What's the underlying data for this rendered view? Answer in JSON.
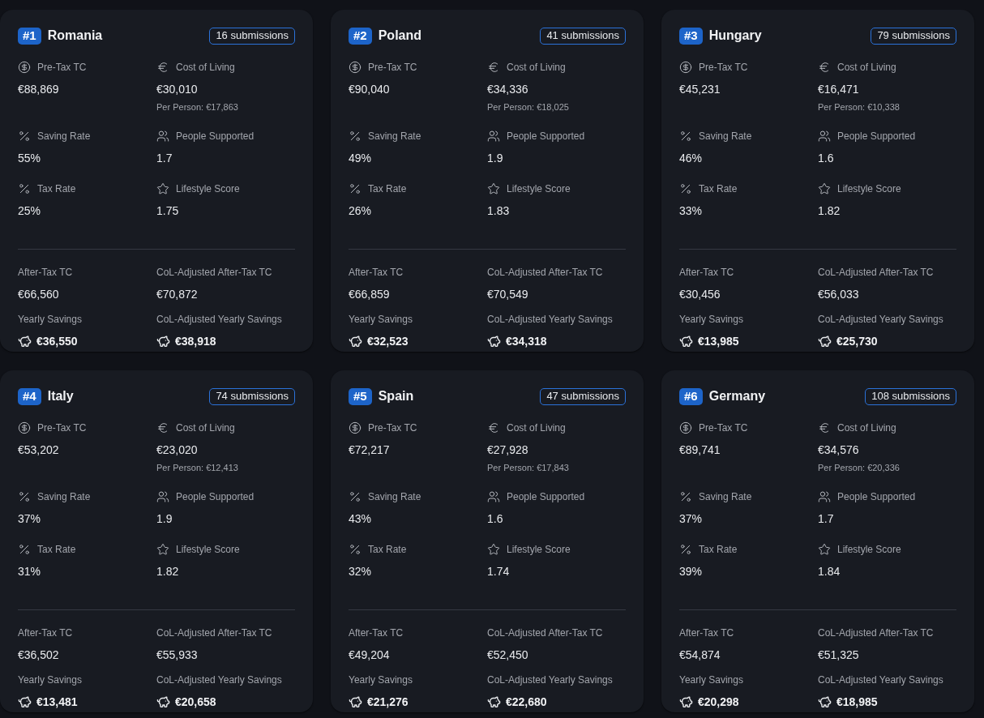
{
  "cards": [
    {
      "rank": "#1",
      "country": "Romania",
      "submissions": "16 submissions",
      "stats": [
        {
          "kind": "dollar",
          "label": "Pre-Tax TC",
          "value": "€88,869"
        },
        {
          "kind": "euro",
          "label": "Cost of Living",
          "value": "€30,010",
          "note": "Per Person: €17,863"
        },
        {
          "kind": "percent",
          "label": "Saving Rate",
          "value": "55%"
        },
        {
          "kind": "people",
          "label": "People Supported",
          "value": "1.7"
        },
        {
          "kind": "percent",
          "label": "Tax Rate",
          "value": "25%"
        },
        {
          "kind": "star",
          "label": "Lifestyle Score",
          "value": "1.75"
        }
      ],
      "summary": [
        {
          "kind": "plain",
          "label": "After-Tax TC",
          "value": "€66,560"
        },
        {
          "kind": "plain",
          "label": "CoL-Adjusted After-Tax TC",
          "value": "€70,872"
        },
        {
          "kind": "savings",
          "label": "Yearly Savings",
          "value": "€36,550"
        },
        {
          "kind": "savings",
          "label": "CoL-Adjusted Yearly Savings",
          "value": "€38,918"
        }
      ]
    },
    {
      "rank": "#2",
      "country": "Poland",
      "submissions": "41 submissions",
      "stats": [
        {
          "kind": "dollar",
          "label": "Pre-Tax TC",
          "value": "€90,040"
        },
        {
          "kind": "euro",
          "label": "Cost of Living",
          "value": "€34,336",
          "note": "Per Person: €18,025"
        },
        {
          "kind": "percent",
          "label": "Saving Rate",
          "value": "49%"
        },
        {
          "kind": "people",
          "label": "People Supported",
          "value": "1.9"
        },
        {
          "kind": "percent",
          "label": "Tax Rate",
          "value": "26%"
        },
        {
          "kind": "star",
          "label": "Lifestyle Score",
          "value": "1.83"
        }
      ],
      "summary": [
        {
          "kind": "plain",
          "label": "After-Tax TC",
          "value": "€66,859"
        },
        {
          "kind": "plain",
          "label": "CoL-Adjusted After-Tax TC",
          "value": "€70,549"
        },
        {
          "kind": "savings",
          "label": "Yearly Savings",
          "value": "€32,523"
        },
        {
          "kind": "savings",
          "label": "CoL-Adjusted Yearly Savings",
          "value": "€34,318"
        }
      ]
    },
    {
      "rank": "#3",
      "country": "Hungary",
      "submissions": "79 submissions",
      "stats": [
        {
          "kind": "dollar",
          "label": "Pre-Tax TC",
          "value": "€45,231"
        },
        {
          "kind": "euro",
          "label": "Cost of Living",
          "value": "€16,471",
          "note": "Per Person: €10,338"
        },
        {
          "kind": "percent",
          "label": "Saving Rate",
          "value": "46%"
        },
        {
          "kind": "people",
          "label": "People Supported",
          "value": "1.6"
        },
        {
          "kind": "percent",
          "label": "Tax Rate",
          "value": "33%"
        },
        {
          "kind": "star",
          "label": "Lifestyle Score",
          "value": "1.82"
        }
      ],
      "summary": [
        {
          "kind": "plain",
          "label": "After-Tax TC",
          "value": "€30,456"
        },
        {
          "kind": "plain",
          "label": "CoL-Adjusted After-Tax TC",
          "value": "€56,033"
        },
        {
          "kind": "savings",
          "label": "Yearly Savings",
          "value": "€13,985"
        },
        {
          "kind": "savings",
          "label": "CoL-Adjusted Yearly Savings",
          "value": "€25,730"
        }
      ]
    },
    {
      "rank": "#4",
      "country": "Italy",
      "submissions": "74 submissions",
      "stats": [
        {
          "kind": "dollar",
          "label": "Pre-Tax TC",
          "value": "€53,202"
        },
        {
          "kind": "euro",
          "label": "Cost of Living",
          "value": "€23,020",
          "note": "Per Person: €12,413"
        },
        {
          "kind": "percent",
          "label": "Saving Rate",
          "value": "37%"
        },
        {
          "kind": "people",
          "label": "People Supported",
          "value": "1.9"
        },
        {
          "kind": "percent",
          "label": "Tax Rate",
          "value": "31%"
        },
        {
          "kind": "star",
          "label": "Lifestyle Score",
          "value": "1.82"
        }
      ],
      "summary": [
        {
          "kind": "plain",
          "label": "After-Tax TC",
          "value": "€36,502"
        },
        {
          "kind": "plain",
          "label": "CoL-Adjusted After-Tax TC",
          "value": "€55,933"
        },
        {
          "kind": "savings",
          "label": "Yearly Savings",
          "value": "€13,481"
        },
        {
          "kind": "savings",
          "label": "CoL-Adjusted Yearly Savings",
          "value": "€20,658"
        }
      ]
    },
    {
      "rank": "#5",
      "country": "Spain",
      "submissions": "47 submissions",
      "stats": [
        {
          "kind": "dollar",
          "label": "Pre-Tax TC",
          "value": "€72,217"
        },
        {
          "kind": "euro",
          "label": "Cost of Living",
          "value": "€27,928",
          "note": "Per Person: €17,843"
        },
        {
          "kind": "percent",
          "label": "Saving Rate",
          "value": "43%"
        },
        {
          "kind": "people",
          "label": "People Supported",
          "value": "1.6"
        },
        {
          "kind": "percent",
          "label": "Tax Rate",
          "value": "32%"
        },
        {
          "kind": "star",
          "label": "Lifestyle Score",
          "value": "1.74"
        }
      ],
      "summary": [
        {
          "kind": "plain",
          "label": "After-Tax TC",
          "value": "€49,204"
        },
        {
          "kind": "plain",
          "label": "CoL-Adjusted After-Tax TC",
          "value": "€52,450"
        },
        {
          "kind": "savings",
          "label": "Yearly Savings",
          "value": "€21,276"
        },
        {
          "kind": "savings",
          "label": "CoL-Adjusted Yearly Savings",
          "value": "€22,680"
        }
      ]
    },
    {
      "rank": "#6",
      "country": "Germany",
      "submissions": "108 submissions",
      "stats": [
        {
          "kind": "dollar",
          "label": "Pre-Tax TC",
          "value": "€89,741"
        },
        {
          "kind": "euro",
          "label": "Cost of Living",
          "value": "€34,576",
          "note": "Per Person: €20,336"
        },
        {
          "kind": "percent",
          "label": "Saving Rate",
          "value": "37%"
        },
        {
          "kind": "people",
          "label": "People Supported",
          "value": "1.7"
        },
        {
          "kind": "percent",
          "label": "Tax Rate",
          "value": "39%"
        },
        {
          "kind": "star",
          "label": "Lifestyle Score",
          "value": "1.84"
        }
      ],
      "summary": [
        {
          "kind": "plain",
          "label": "After-Tax TC",
          "value": "€54,874"
        },
        {
          "kind": "plain",
          "label": "CoL-Adjusted After-Tax TC",
          "value": "€51,325"
        },
        {
          "kind": "savings",
          "label": "Yearly Savings",
          "value": "€20,298"
        },
        {
          "kind": "savings",
          "label": "CoL-Adjusted Yearly Savings",
          "value": "€18,985"
        }
      ]
    }
  ]
}
